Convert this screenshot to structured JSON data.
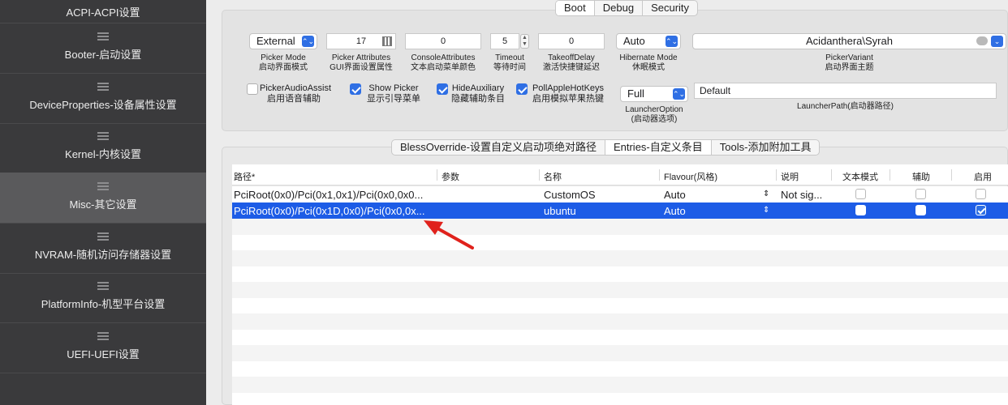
{
  "sidebar": {
    "items": [
      {
        "label": "ACPI-ACPI设置"
      },
      {
        "label": "Booter-启动设置"
      },
      {
        "label": "DeviceProperties-设备属性设置"
      },
      {
        "label": "Kernel-内核设置"
      },
      {
        "label": "Misc-其它设置"
      },
      {
        "label": "NVRAM-随机访问存储器设置"
      },
      {
        "label": "PlatformInfo-机型平台设置"
      },
      {
        "label": "UEFI-UEFI设置"
      }
    ]
  },
  "top_tabs": [
    "Boot",
    "Debug",
    "Security"
  ],
  "boot": {
    "picker_mode": {
      "value": "External",
      "caption1": "Picker Mode",
      "caption2": "启动界面模式"
    },
    "picker_attributes": {
      "value": "17",
      "caption1": "Picker Attributes",
      "caption2": "GUI界面设置属性"
    },
    "console_attributes": {
      "value": "0",
      "caption1": "ConsoleAttributes",
      "caption2": "文本启动菜单颜色"
    },
    "timeout": {
      "value": "5",
      "caption1": "Timeout",
      "caption2": "等待时间"
    },
    "takeoff_delay": {
      "value": "0",
      "caption1": "TakeoffDelay",
      "caption2": "激活快捷键延迟"
    },
    "hibernate_mode": {
      "value": "Auto",
      "caption1": "Hibernate Mode",
      "caption2": "休眠模式"
    },
    "picker_variant": {
      "value": "Acidanthera\\Syrah",
      "caption1": "PickerVariant",
      "caption2": "启动界面主题"
    },
    "picker_audio_assist": {
      "label1": "PickerAudioAssist",
      "label2": "启用语音辅助",
      "checked": false
    },
    "show_picker": {
      "label1": "Show Picker",
      "label2": "显示引导菜单",
      "checked": true
    },
    "hide_auxiliary": {
      "label1": "HideAuxiliary",
      "label2": "隐藏辅助条目",
      "checked": true
    },
    "poll_apple_hotkeys": {
      "label1": "PollAppleHotKeys",
      "label2": "启用模拟苹果热键",
      "checked": true
    },
    "launcher_option": {
      "value": "Full",
      "caption1": "LauncherOption",
      "caption2": "(启动器选项)"
    },
    "launcher_path": {
      "value": "Default",
      "caption": "LauncherPath(启动器路径)"
    }
  },
  "sub_tabs": [
    "BlessOverride-设置自定义启动项绝对路径",
    "Entries-自定义条目",
    "Tools-添加附加工具"
  ],
  "table": {
    "headers": [
      "路径*",
      "参数",
      "名称",
      "Flavour(风格)",
      "说明",
      "文本模式",
      "辅助",
      "启用"
    ],
    "rows": [
      {
        "path": "PciRoot(0x0)/Pci(0x1,0x1)/Pci(0x0,0x0...",
        "args": "",
        "name": "CustomOS",
        "flavour": "Auto",
        "comment": "Not sig...",
        "text_mode": false,
        "auxiliary": false,
        "enabled": false
      },
      {
        "path": "PciRoot(0x0)/Pci(0x1D,0x0)/Pci(0x0,0x...",
        "args": "",
        "name": "ubuntu",
        "flavour": "Auto",
        "comment": "",
        "text_mode": false,
        "auxiliary": false,
        "enabled": true
      }
    ]
  },
  "colors": {
    "accent": "#2f6fe4",
    "selection": "#1d5ce6",
    "arrow": "#e0221c"
  },
  "icons": {
    "list": "list-icon",
    "dropdown": "chevron-updown-icon",
    "color_picker": "color-grid-icon",
    "theme": "palette-icon"
  }
}
